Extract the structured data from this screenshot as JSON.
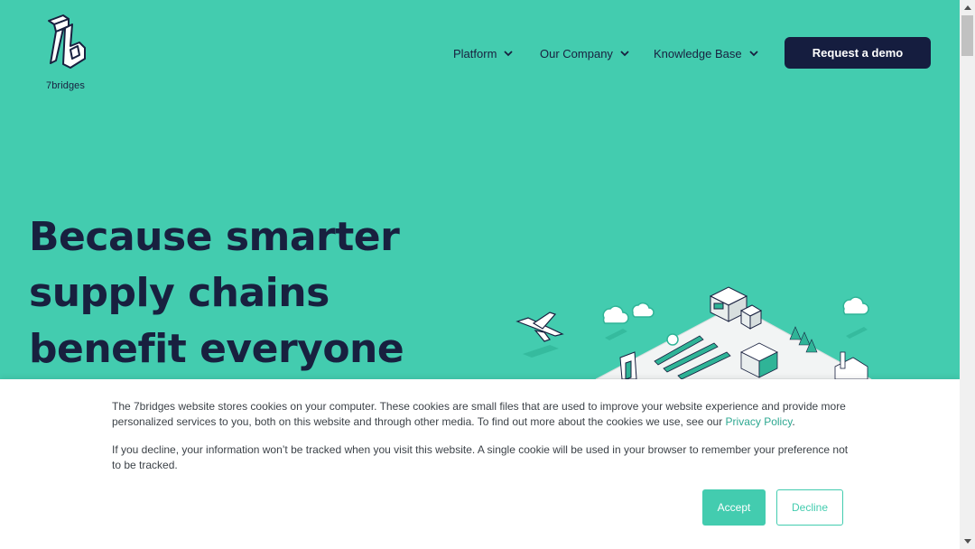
{
  "brand": {
    "name": "7bridges"
  },
  "nav": {
    "items": [
      {
        "label": "Platform"
      },
      {
        "label": "Our Company"
      },
      {
        "label": "Knowledge Base"
      }
    ],
    "cta_label": "Request a demo"
  },
  "hero": {
    "title_lines": [
      "Because smarter",
      "supply chains",
      "benefit everyone"
    ]
  },
  "cookie_banner": {
    "text_1": "The 7bridges website stores cookies on your computer. These cookies are small files that are used to improve your website experience and provide more personalized services to you, both on this website and through other media. To find out more about the cookies we use, see our ",
    "privacy_link": "Privacy Policy",
    "text_1_end": ".",
    "text_2": "If you decline, your information won’t be tracked when you visit this website. A single cookie will be used in your browser to remember your preference not to be tracked.",
    "accept_label": "Accept",
    "decline_label": "Decline"
  },
  "colors": {
    "brand_green": "#43ccaf",
    "navy": "#151d3f",
    "link": "#2ea891"
  },
  "icons": [
    "logo-icon",
    "chevron-down-icon",
    "scroll-up-arrow-icon",
    "scroll-down-arrow-icon"
  ]
}
